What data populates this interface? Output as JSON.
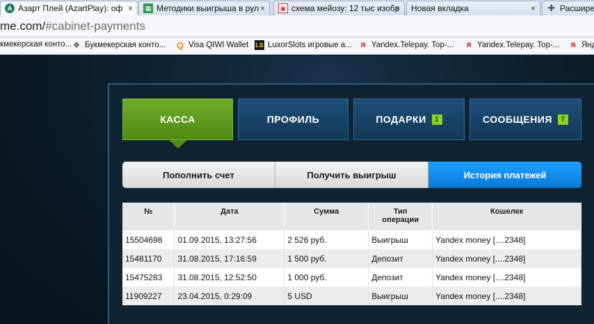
{
  "browser": {
    "tabs": [
      {
        "label": "Азарт Плей (AzartPlay): оф",
        "icon": "azartplay-icon",
        "active": true
      },
      {
        "label": "Методики выигрыша в рул",
        "icon": "sheets-icon",
        "active": false
      },
      {
        "label": "схема мейозу: 12 тыс изобр",
        "icon": "image-icon",
        "active": false
      },
      {
        "label": "Новая вкладка",
        "icon": "",
        "active": false
      },
      {
        "label": "Расширени",
        "icon": "puzzle-icon",
        "active": false
      }
    ],
    "close_glyph": "×",
    "url_prefix": "me.com/",
    "url_path": "#cabinet-payments",
    "bookmarks": [
      {
        "label": "кмекерская конто...",
        "icon": ""
      },
      {
        "label": "Букмекерская конто...",
        "icon": "bookmark-icon"
      },
      {
        "label": "Visa QIWI Wallet",
        "icon": "qiwi-icon"
      },
      {
        "label": "LuxorSlots игровые а...",
        "icon": "ls-icon"
      },
      {
        "label": "Yandex.Telepay. Top-...",
        "icon": "yandex-icon"
      },
      {
        "label": "Yandex.Telepay. Top-...",
        "icon": "yandex-icon"
      },
      {
        "label": "Янд",
        "icon": "yandex-icon"
      }
    ]
  },
  "nav": {
    "tabs": [
      {
        "label": "КАССА",
        "badge": "",
        "active": true
      },
      {
        "label": "ПРОФИЛЬ",
        "badge": "",
        "active": false
      },
      {
        "label": "ПОДАРКИ",
        "badge": "1",
        "active": false
      },
      {
        "label": "СООБЩЕНИЯ",
        "badge": "7",
        "active": false
      }
    ]
  },
  "subnav": {
    "tabs": [
      {
        "label": "Пополнить счет",
        "active": false
      },
      {
        "label": "Получить выигрыш",
        "active": false
      },
      {
        "label": "История платежей",
        "active": true
      }
    ]
  },
  "table": {
    "headers": [
      "№",
      "Дата",
      "Сумма",
      "Тип операции",
      "Кошелек"
    ],
    "rows": [
      [
        "15504698",
        "01.09.2015, 13:27:56",
        "2 526 руб.",
        "Выигрыш",
        "Yandex money [....2348]"
      ],
      [
        "15481170",
        "31.08.2015, 17:16:59",
        "1 500 руб.",
        "Депозит",
        "Yandex money [....2348]"
      ],
      [
        "15475283",
        "31.08.2015, 12:52:50",
        "1 000 руб.",
        "Депозит",
        "Yandex money [....2348]"
      ],
      [
        "11909227",
        "23.04.2015, 0:29:09",
        "5 USD",
        "Выигрыш",
        "Yandex money [....2348]"
      ]
    ]
  },
  "colors": {
    "nav_active": "#5f9b1f",
    "nav_inactive": "#1a4468",
    "subnav_active": "#1590ee",
    "badge": "#8bd31f"
  }
}
